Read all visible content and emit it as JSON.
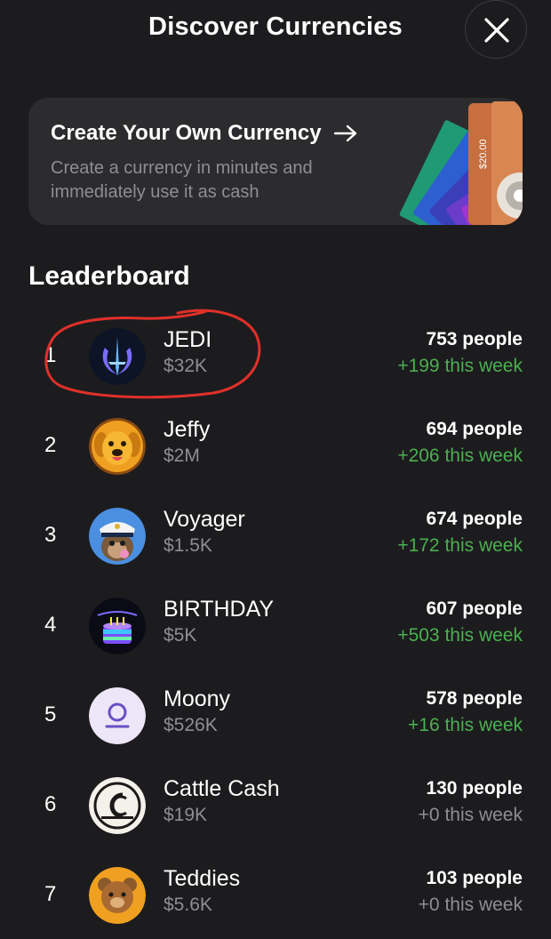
{
  "header": {
    "title": "Discover Currencies",
    "close_icon": "close-icon"
  },
  "create_card": {
    "title": "Create Your Own Currency",
    "subtitle_line1": "Create a currency in minutes and",
    "subtitle_line2": "immediately use it as cash",
    "bill_label": "$20.00"
  },
  "leaderboard": {
    "title": "Leaderboard",
    "rows": [
      {
        "rank": "1",
        "name": "JEDI",
        "value": "$32K",
        "people": "753 people",
        "weekly": "+199 this week",
        "icon": "jedi-order-icon"
      },
      {
        "rank": "2",
        "name": "Jeffy",
        "value": "$2M",
        "people": "694 people",
        "weekly": "+206 this week",
        "icon": "dog-icon"
      },
      {
        "rank": "3",
        "name": "Voyager",
        "value": "$1.5K",
        "people": "674 people",
        "weekly": "+172 this week",
        "icon": "captain-ape-icon"
      },
      {
        "rank": "4",
        "name": "BIRTHDAY",
        "value": "$5K",
        "people": "607 people",
        "weekly": "+503 this week",
        "icon": "birthday-cake-icon"
      },
      {
        "rank": "5",
        "name": "Moony",
        "value": "$526K",
        "people": "578 people",
        "weekly": "+16 this week",
        "icon": "moon-symbol-icon"
      },
      {
        "rank": "6",
        "name": "Cattle Cash",
        "value": "$19K",
        "people": "130 people",
        "weekly": "+0 this week",
        "icon": "cattle-cash-logo-icon"
      },
      {
        "rank": "7",
        "name": "Teddies",
        "value": "$5.6K",
        "people": "103 people",
        "weekly": "+0 this week",
        "icon": "teddy-bear-icon"
      }
    ]
  },
  "colors": {
    "background": "#1c1c1e",
    "card": "#2c2c2e",
    "positive": "#4caf50",
    "muted": "#8e8e93",
    "annotation": "#e0302a"
  }
}
